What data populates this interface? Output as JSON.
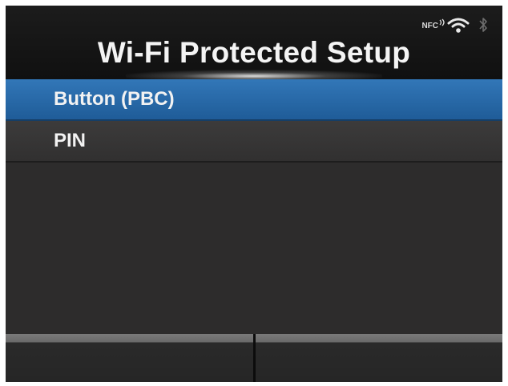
{
  "header": {
    "title": "Wi-Fi Protected Setup",
    "status_icons": [
      {
        "name": "nfc-icon",
        "label": "NFC"
      },
      {
        "name": "wifi-icon"
      },
      {
        "name": "bluetooth-icon"
      }
    ]
  },
  "menu": {
    "items": [
      {
        "label": "Button (PBC)",
        "selected": true
      },
      {
        "label": "PIN",
        "selected": false
      }
    ]
  },
  "softkeys": [
    {
      "label": ""
    },
    {
      "label": ""
    }
  ],
  "colors": {
    "selection": "#2a6aa9",
    "background": "#2d2c2c",
    "header": "#141414"
  }
}
